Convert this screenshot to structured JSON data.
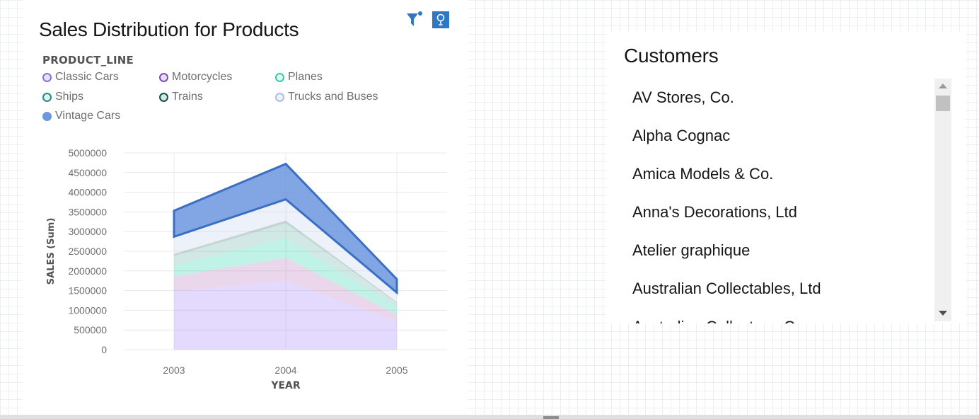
{
  "chart_panel": {
    "title": "Sales Distribution for Products",
    "legend_title": "PRODUCT_LINE",
    "toolbar": {
      "filter_icon": "filter-icon",
      "insight_icon": "lightbulb-icon"
    }
  },
  "chart_data": {
    "type": "area",
    "stacked": true,
    "title": "Sales Distribution for Products",
    "xlabel": "YEAR",
    "ylabel": "SALES (Sum)",
    "x": [
      "2003",
      "2004",
      "2005"
    ],
    "ylim": [
      0,
      5000000
    ],
    "yticks": [
      0,
      500000,
      1000000,
      1500000,
      2000000,
      2500000,
      3000000,
      3500000,
      4000000,
      4500000,
      5000000
    ],
    "ytick_labels": [
      "0",
      "500000",
      "1000000",
      "1500000",
      "2000000",
      "2500000",
      "3000000",
      "3500000",
      "4000000",
      "4500000",
      "5000000"
    ],
    "grid": true,
    "legend_position": "top-left",
    "series": [
      {
        "name": "Classic Cars",
        "values": [
          1480000,
          1760000,
          700000
        ],
        "color": "#a78bfa"
      },
      {
        "name": "Motorcycles",
        "values": [
          380000,
          570000,
          190000
        ],
        "color": "#c084c4"
      },
      {
        "name": "Planes",
        "values": [
          280000,
          510000,
          180000
        ],
        "color": "#3dd6b3"
      },
      {
        "name": "Ships",
        "values": [
          240000,
          370000,
          120000
        ],
        "color": "#6fb8ad"
      },
      {
        "name": "Trains",
        "values": [
          50000,
          70000,
          20000
        ],
        "color": "#4a7f72"
      },
      {
        "name": "Trucks and Buses",
        "values": [
          440000,
          540000,
          240000
        ],
        "color": "#c6d2f0"
      },
      {
        "name": "Vintage Cars",
        "values": [
          660000,
          900000,
          340000
        ],
        "color": "#6b97de",
        "highlighted": true
      }
    ]
  },
  "legend_items": [
    {
      "label": "Classic Cars",
      "fill": "#e8e0ff",
      "stroke": "#8a6fd9"
    },
    {
      "label": "Motorcycles",
      "fill": "#eadcf7",
      "stroke": "#7b4fb0"
    },
    {
      "label": "Planes",
      "fill": "#e0faf2",
      "stroke": "#3bc9a6"
    },
    {
      "label": "Ships",
      "fill": "#dcf5ef",
      "stroke": "#1f8f82"
    },
    {
      "label": "Trains",
      "fill": "#cfe8e1",
      "stroke": "#1b4f45"
    },
    {
      "label": "Trucks and Buses",
      "fill": "#eef2fb",
      "stroke": "#a9bde8"
    },
    {
      "label": "Vintage Cars",
      "fill": "#6b97de",
      "stroke": "#6b97de"
    }
  ],
  "customers_panel": {
    "title": "Customers",
    "items": [
      "AV Stores, Co.",
      "Alpha Cognac",
      "Amica Models & Co.",
      "Anna's Decorations, Ltd",
      "Atelier graphique",
      "Australian Collectables, Ltd",
      "Australian Collectors, Co."
    ]
  }
}
